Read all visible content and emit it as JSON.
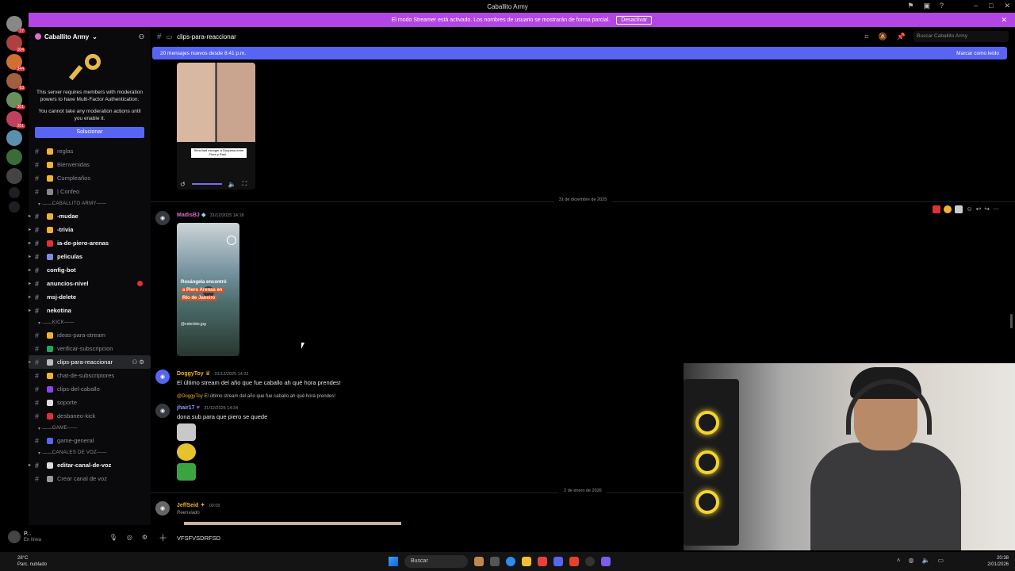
{
  "window": {
    "title": "Caballito Army"
  },
  "streamer_bar": {
    "text": "El modo Streamer está activado. Los nombres de usuario se mostrarán de forma parcial.",
    "button": "Desactivar"
  },
  "rail_badges": [
    "77",
    "104",
    "344",
    "63",
    "301",
    "261"
  ],
  "server": {
    "name": "Caballito Army"
  },
  "mfa": {
    "line1": "This server requires members with moderation powers to have Multi-Factor Authentication.",
    "line2": "You cannot take any moderation actions until you enable it.",
    "button": "Solucionar"
  },
  "channels_top": [
    {
      "label": "reglas",
      "bold": false,
      "color": "#f0b232"
    },
    {
      "label": "Bienvenidas",
      "bold": false,
      "color": "#f0b232"
    },
    {
      "label": "Cumpleaños",
      "bold": false,
      "color": "#f0b232"
    },
    {
      "label": "| Confeo",
      "bold": false,
      "color": "#888888"
    }
  ],
  "category_army": "CABALLITO ARMY",
  "channels_army": [
    {
      "label": "-mudae",
      "bold": true,
      "color": "#f0b232"
    },
    {
      "label": "-trivia",
      "bold": true,
      "color": "#f0b232"
    },
    {
      "label": "ia-de-piero-arenas",
      "bold": true,
      "color": "#e0303b"
    },
    {
      "label": "peliculas",
      "bold": true,
      "color": "#7d8ce0"
    },
    {
      "label": "config-bot",
      "bold": true,
      "color": ""
    },
    {
      "label": "anuncios-nivel",
      "bold": true,
      "color": ""
    },
    {
      "label": "msj-delete",
      "bold": true,
      "color": ""
    },
    {
      "label": "nekotina",
      "bold": true,
      "color": ""
    }
  ],
  "category_kick": "KICK",
  "channels_kick": [
    {
      "label": "ideas-para-stream",
      "color": "#f0b232"
    },
    {
      "label": "verificar-subscripcion",
      "color": "#23a55a"
    },
    {
      "label": "clips-para-reaccionar",
      "color": "#bbbbbb"
    },
    {
      "label": "chat-de-subscriptores",
      "color": "#f0b232"
    },
    {
      "label": "clips-del-caballo",
      "color": "#8e44ec"
    },
    {
      "label": "soporte",
      "color": "#dddddd"
    },
    {
      "label": "desbaneo-kick",
      "color": "#e0303b"
    }
  ],
  "category_game": "GAME",
  "channels_game": [
    {
      "label": "game-general",
      "color": "#5865f2"
    }
  ],
  "category_voice": "CANALES DE VOZ",
  "channels_voice": [
    {
      "label": "editar-canal-de-voz",
      "color": "#dddddd"
    },
    {
      "label": "Crear canal de voz",
      "color": "#999999"
    }
  ],
  "user": {
    "name": "P...",
    "status": "En línea"
  },
  "channel_header": {
    "name": "clips-para-reaccionar",
    "search_placeholder": "Buscar Caballito Army"
  },
  "new_messages": {
    "text": "20 mensajes nuevos desde 8:41 p.m.",
    "action": "Marcar como leído"
  },
  "chat": {
    "video1_caption": "Sera facil escoger a Duquesa entre Fiora y Raul...",
    "date1": "31 de diciembre de 2025",
    "msg1": {
      "author": "MadisBJ",
      "author_color": "#e26bd6",
      "time": "31/12/2025 14:18"
    },
    "video2_lines": [
      "Rosángela encontró",
      "a Piero Arenas en",
      "Río de Janeiro"
    ],
    "video2_handle": "@cnbchito.jpg",
    "msg2": {
      "author": "DoggyToy",
      "author_color": "#f0b232",
      "time": "31/12/2025 14:22",
      "text": "El último stream del año que fue caballo ah qué hora prendes!"
    },
    "reply_ref": {
      "author": "@DoggyToy",
      "text": "El último stream del año que fue caballo ah qué hora prendes!"
    },
    "msg3": {
      "author": "jhair17",
      "author_color": "#8e9bf2",
      "time": "31/12/2025 14:34",
      "text": "dona sub para que piero se quede"
    },
    "date2": "2 de enero de 2026",
    "msg4": {
      "author": "JeffSeid",
      "author_color": "#f0b232",
      "time": "00:09",
      "text": "Reenviado"
    }
  },
  "composer": {
    "value": "VFSFVSDRFSD"
  },
  "taskbar": {
    "temp": "28°C",
    "weather": "Parc. nublado",
    "search": "Buscar",
    "time": "20:38",
    "date": "2/01/2026"
  }
}
